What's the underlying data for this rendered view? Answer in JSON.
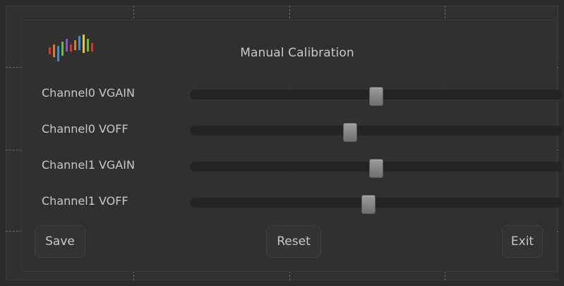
{
  "dialog": {
    "title": "Manual Calibration",
    "logo": "color-bars-logo",
    "sliders": [
      {
        "label": "Channel0 VGAIN",
        "value": 0.5
      },
      {
        "label": "Channel0 VOFF",
        "value": 0.43
      },
      {
        "label": "Channel1 VGAIN",
        "value": 0.5
      },
      {
        "label": "Channel1 VOFF",
        "value": 0.48
      }
    ],
    "buttons": {
      "save": "Save",
      "reset": "Reset",
      "exit": "Exit"
    }
  },
  "colors": {
    "background": "#2c2c2c",
    "panel": "#303030",
    "text": "#c8c8c8",
    "track": "#232323",
    "handle": "#8a8a8a"
  }
}
